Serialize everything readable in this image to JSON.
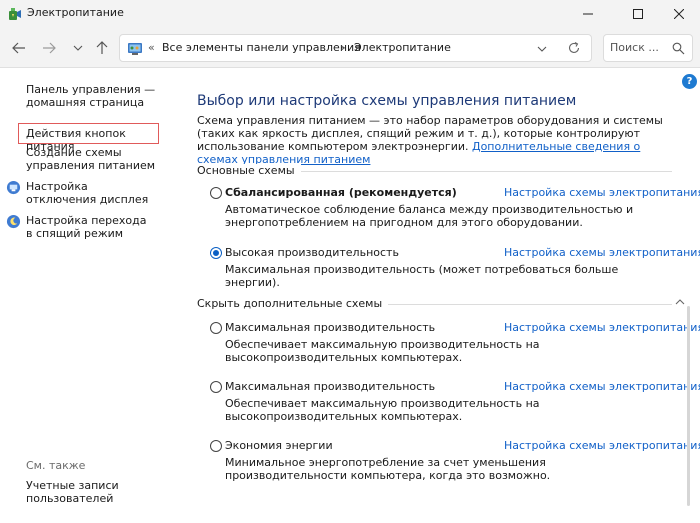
{
  "window": {
    "title": "Электропитание"
  },
  "navigation": {
    "breadcrumb_prefix": "«",
    "breadcrumb_1": "Все элементы панели управления",
    "breadcrumb_sep": "›",
    "breadcrumb_2": "Электропитание",
    "search_placeholder": "Поиск ..."
  },
  "sidebar": {
    "home_link": "Панель управления — домашняя страница",
    "power_buttons_link": "Действия кнопок питания",
    "create_plan_link": "Создание схемы управления питанием",
    "display_off_link": "Настройка отключения дисплея",
    "sleep_link": "Настройка перехода в спящий режим",
    "see_also_label": "См. также",
    "user_accounts_link": "Учетные записи пользователей"
  },
  "main": {
    "title": "Выбор или настройка схемы управления питанием",
    "intro_text": "Схема управления питанием — это набор параметров оборудования и системы (таких как яркость дисплея, спящий режим и т. д.), которые контролируют использование компьютером электроэнергии.",
    "intro_link": "Дополнительные сведения о схемах управления питанием",
    "group_main_label": "Основные схемы",
    "group_hidden_label": "Скрыть дополнительные схемы",
    "plans": [
      {
        "name": "Сбалансированная (рекомендуется)",
        "link": "Настройка схемы электропитания",
        "description": "Автоматическое соблюдение баланса между производительностью и энергопотреблением на пригодном для этого оборудовании.",
        "selected": false
      },
      {
        "name": "Высокая производительность",
        "link": "Настройка схемы электропитания",
        "description": "Максимальная производительность (может потребоваться больше энергии).",
        "selected": true
      },
      {
        "name": "Максимальная производительность",
        "link": "Настройка схемы электропитания",
        "description": "Обеспечивает максимальную производительность на высокопроизводительных компьютерах.",
        "selected": false
      },
      {
        "name": "Максимальная производительность",
        "link": "Настройка схемы электропитания",
        "description": "Обеспечивает максимальную производительность на высокопроизводительных компьютерах.",
        "selected": false
      },
      {
        "name": "Экономия энергии",
        "link": "Настройка схемы электропитания",
        "description": "Минимальное энергопотребление за счет уменьшения производительности компьютера, когда это возможно.",
        "selected": false
      }
    ]
  },
  "colors": {
    "accent": "#0a5fc4",
    "link": "#1160c8",
    "title": "#1e3a78",
    "highlight_box": "#e05a5a"
  },
  "icons": {
    "app": "power-options-icon",
    "minimize": "minimize-icon",
    "maximize": "maximize-icon",
    "close": "close-icon",
    "back": "arrow-left-icon",
    "forward": "arrow-right-icon",
    "recent": "chevron-down-icon",
    "up": "arrow-up-icon",
    "control_panel": "control-panel-icon",
    "refresh": "refresh-icon",
    "search": "search-icon",
    "help": "help-icon",
    "shield": "shield-icon"
  }
}
